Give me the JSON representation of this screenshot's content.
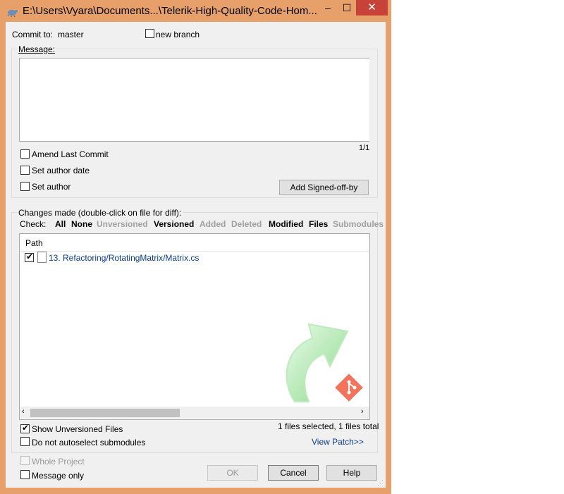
{
  "window": {
    "title": "E:\\Users\\Vyara\\Documents...\\Telerik-High-Quality-Code-Hom...",
    "minimize": "–",
    "maximize": "☐",
    "close": "✕"
  },
  "commit": {
    "label": "Commit to:",
    "branch": "master",
    "new_branch_label": "new branch"
  },
  "message": {
    "group_label": "Message:",
    "value": "",
    "counter": "1/1",
    "amend_label": "Amend Last Commit",
    "set_author_date_label": "Set author date",
    "set_author_label": "Set author",
    "signed_off_button": "Add Signed-off-by"
  },
  "changes": {
    "group_label": "Changes made (double-click on file for diff):",
    "check_label": "Check:",
    "filters": [
      {
        "label": "All",
        "enabled": true
      },
      {
        "label": "None",
        "enabled": true
      },
      {
        "label": "Unversioned",
        "enabled": false
      },
      {
        "label": "Versioned",
        "enabled": true
      },
      {
        "label": "Added",
        "enabled": false
      },
      {
        "label": "Deleted",
        "enabled": false
      },
      {
        "label": "Modified",
        "enabled": true
      },
      {
        "label": "Files",
        "enabled": true
      },
      {
        "label": "Submodules",
        "enabled": false
      }
    ],
    "column_header": "Path",
    "files": [
      {
        "path": "13. Refactoring/RotatingMatrix/Matrix.cs",
        "checked": true
      }
    ],
    "show_unversioned_label": "Show Unversioned Files",
    "show_unversioned_checked": true,
    "no_autoselect_label": "Do not autoselect submodules",
    "no_autoselect_checked": false,
    "selection_status": "1 files selected, 1 files total",
    "view_patch_link": "View Patch>>"
  },
  "footer": {
    "whole_project_label": "Whole Project",
    "message_only_label": "Message only",
    "ok_button": "OK",
    "cancel_button": "Cancel",
    "help_button": "Help"
  },
  "colors": {
    "window_frame": "#e7a06a",
    "close_button": "#c7433a",
    "dialog_background": "#f0f0f0",
    "link": "#0b3d91",
    "watermark_arrow": "#7ed67e",
    "git_badge": "#f05133"
  },
  "icons": {
    "app": "tortoisegit-icon",
    "file": "file-icon",
    "watermark": "commit-arrow-icon",
    "git_logo": "git-logo-icon"
  }
}
